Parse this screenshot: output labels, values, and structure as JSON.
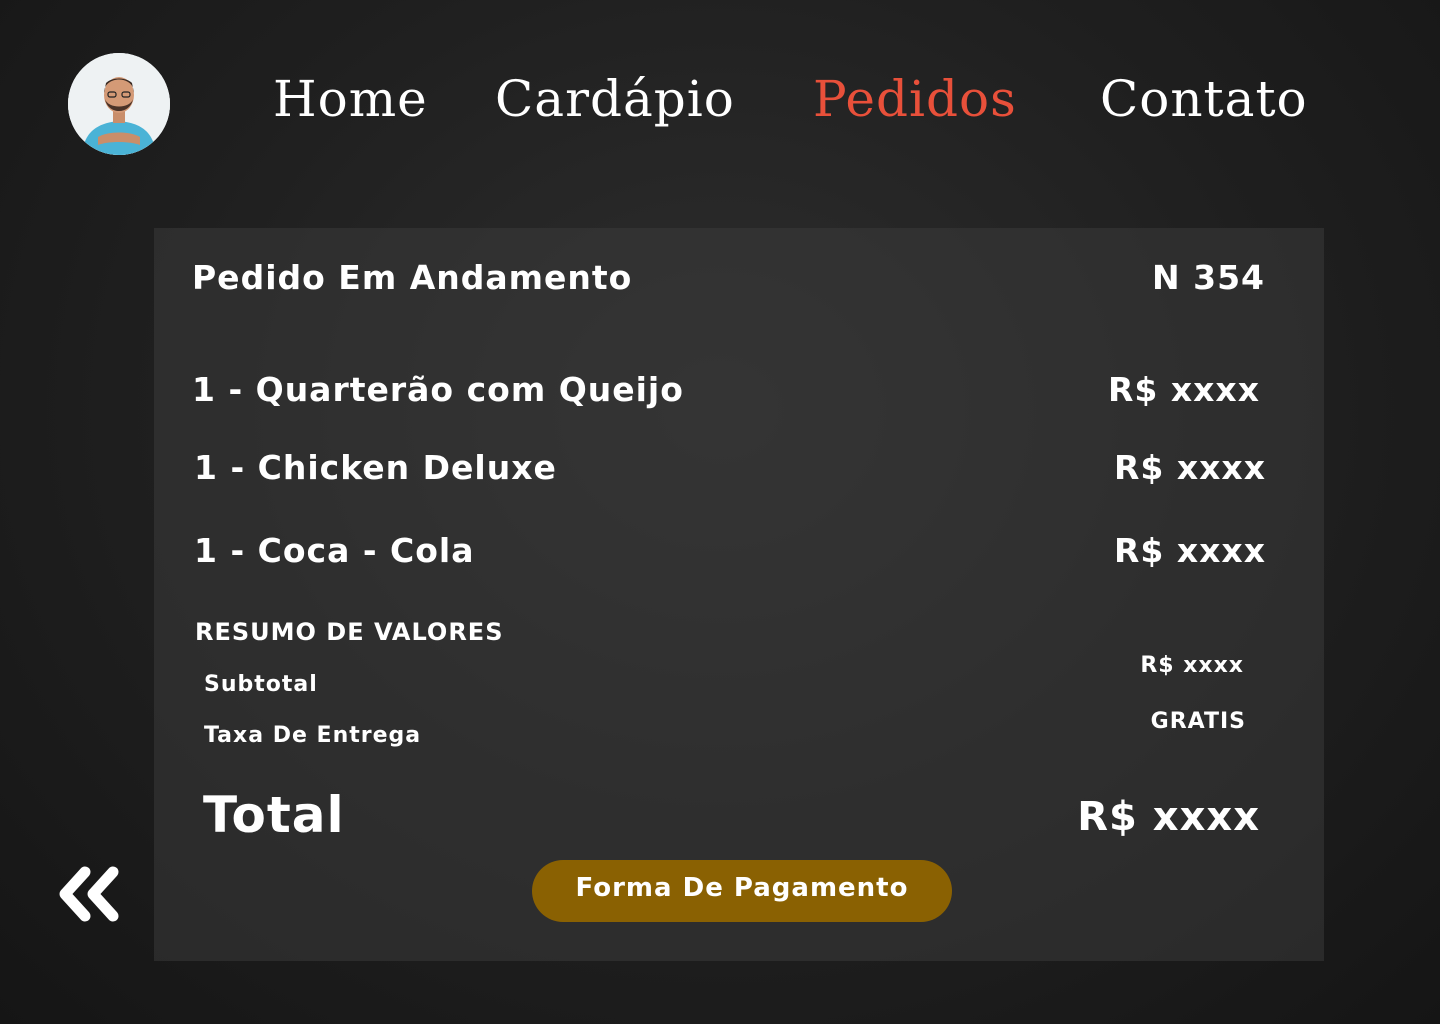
{
  "nav": {
    "items": [
      "Home",
      "Cardápio",
      "Pedidos",
      "Contato"
    ],
    "active": "Pedidos"
  },
  "order": {
    "title": "Pedido Em Andamento",
    "number": "N 354",
    "items": [
      {
        "label": "1 - Quarterão com Queijo",
        "price": "R$ xxxx"
      },
      {
        "label": "1 - Chicken Deluxe",
        "price": "R$ xxxx"
      },
      {
        "label": "1 - Coca - Cola",
        "price": "R$ xxxx"
      }
    ]
  },
  "summary": {
    "heading": "RESUMO DE VALORES",
    "subtotal_label": "Subtotal",
    "subtotal_value": "R$ xxxx",
    "delivery_label": "Taxa De Entrega",
    "delivery_value": "GRATIS",
    "total_label": "Total",
    "total_value": "R$ xxxx"
  },
  "actions": {
    "payment_label": "Forma De Pagamento",
    "back_icon": "double-chevron-left-icon"
  },
  "colors": {
    "accent": "#e8503a",
    "button": "#8a6102",
    "text": "#ffffff"
  }
}
